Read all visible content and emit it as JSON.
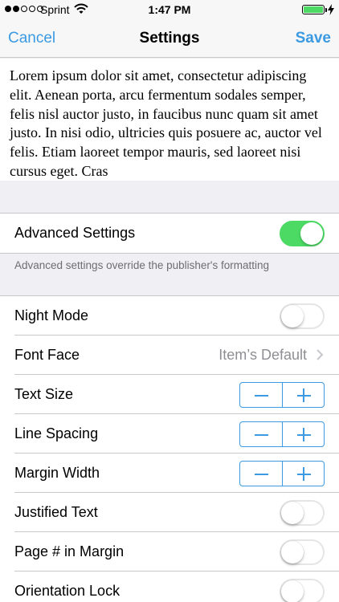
{
  "status_bar": {
    "carrier": "Sprint",
    "time": "1:47 PM",
    "signal_filled": 2,
    "signal_total": 5,
    "battery_level": 1.0,
    "battery_color": "#4cd964"
  },
  "nav": {
    "cancel": "Cancel",
    "title": "Settings",
    "save": "Save",
    "accent": "#3b9ae1"
  },
  "preview": {
    "text": "Lorem ipsum dolor sit amet, consectetur adipiscing elit. Aenean porta, arcu fermentum sodales semper, felis nisl auctor justo, in faucibus nunc quam sit amet justo. In nisi odio, ultricies quis posuere ac, auctor vel felis. Etiam laoreet tempor mauris, sed laoreet nisi cursus eget. Cras"
  },
  "advanced": {
    "label": "Advanced Settings",
    "on": true,
    "footer": "Advanced settings override the publisher's formatting"
  },
  "settings": {
    "night_mode": {
      "label": "Night Mode",
      "on": false
    },
    "font_face": {
      "label": "Font Face",
      "value": "Item’s Default"
    },
    "text_size": {
      "label": "Text Size"
    },
    "line_spacing": {
      "label": "Line Spacing"
    },
    "margin_width": {
      "label": "Margin Width"
    },
    "justified_text": {
      "label": "Justified Text",
      "on": false
    },
    "page_number": {
      "label": "Page # in Margin",
      "on": false
    },
    "orientation_lock": {
      "label": "Orientation Lock",
      "on": false
    }
  },
  "icons": {
    "wifi": "wifi-icon",
    "battery": "battery-icon",
    "charging": "charging-icon",
    "chevron": "chevron-right-icon",
    "minus": "minus-icon",
    "plus": "plus-icon"
  }
}
